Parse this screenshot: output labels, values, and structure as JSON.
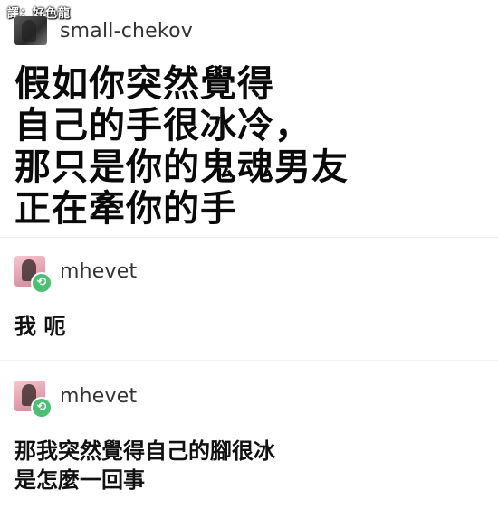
{
  "watermark": "譯：好色龍",
  "posts": [
    {
      "username": "small-chekov",
      "avatar_icon": "user-avatar-dark",
      "reblog": false,
      "body": "假如你突然覺得\n自己的手很冰冷，\n那只是你的鬼魂男友\n正在牽你的手"
    },
    {
      "username": "mhevet",
      "avatar_icon": "user-avatar-pink",
      "reblog": true,
      "reblog_icon": "reblog-icon",
      "body": "我 呃"
    },
    {
      "username": "mhevet",
      "avatar_icon": "user-avatar-pink",
      "reblog": true,
      "reblog_icon": "reblog-icon",
      "body": "那我突然覺得自己的腳很冰\n是怎麼一回事"
    }
  ],
  "colors": {
    "reblog_badge": "#4bbf73",
    "divider": "#efefef",
    "text": "#111111"
  }
}
